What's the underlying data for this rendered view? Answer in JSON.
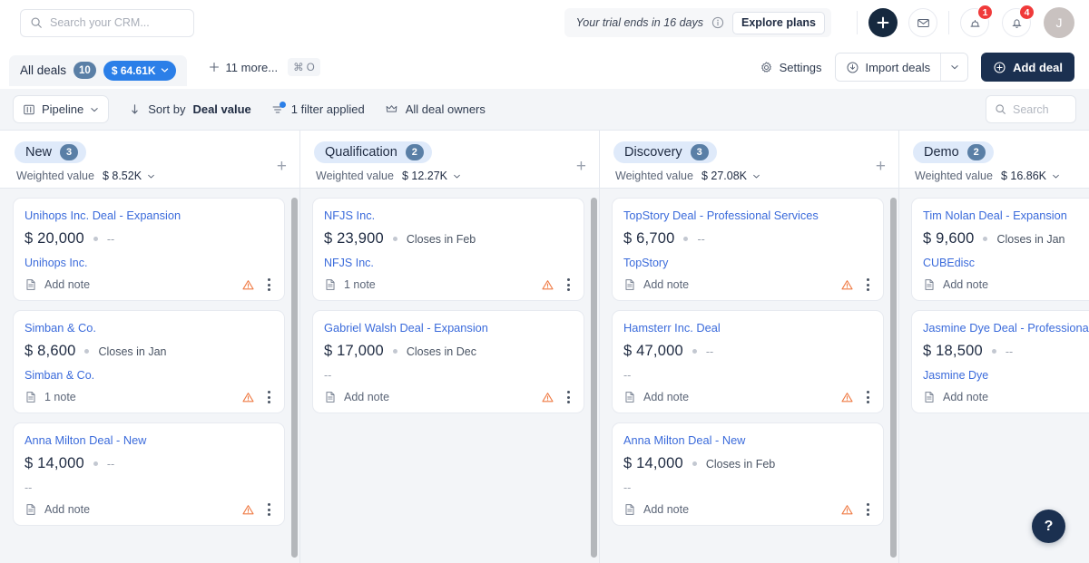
{
  "topbar": {
    "search_placeholder": "Search your CRM...",
    "search_value": "",
    "trial_text": "Your trial ends in 16 days",
    "explore_label": "Explore plans",
    "tasks_badge": "1",
    "notifications_badge": "4",
    "avatar_initial": "J"
  },
  "dealsbar": {
    "tab_label": "All deals",
    "tab_count": "10",
    "tab_value": "$ 64.61K",
    "more_label": "11 more...",
    "shortcut": "⌘ O",
    "settings_label": "Settings",
    "import_label": "Import deals",
    "add_deal_label": "Add deal"
  },
  "filterbar": {
    "pipeline_label": "Pipeline",
    "sort_prefix": "Sort by",
    "sort_field": "Deal value",
    "filter_label": "1 filter applied",
    "owners_label": "All deal owners",
    "search_placeholder": "Search",
    "search_value": ""
  },
  "board": {
    "weighted_label": "Weighted value",
    "add_note_label": "Add note",
    "empty_value": "--",
    "columns": [
      {
        "name": "New",
        "count": "3",
        "weighted_value": "$ 8.52K",
        "cards": [
          {
            "title": "Unihops Inc. Deal - Expansion",
            "amount": "$ 20,000",
            "close": "--",
            "close_empty": true,
            "org": "Unihops Inc.",
            "org_empty": false,
            "note": "Add note",
            "warning": true
          },
          {
            "title": "Simban & Co.",
            "amount": "$ 8,600",
            "close": "Closes in Jan",
            "close_empty": false,
            "org": "Simban & Co.",
            "org_empty": false,
            "note": "1 note",
            "warning": true
          },
          {
            "title": "Anna Milton Deal - New",
            "amount": "$ 14,000",
            "close": "--",
            "close_empty": true,
            "org": "--",
            "org_empty": true,
            "note": "Add note",
            "warning": true
          }
        ]
      },
      {
        "name": "Qualification",
        "count": "2",
        "weighted_value": "$ 12.27K",
        "cards": [
          {
            "title": "NFJS Inc.",
            "amount": "$ 23,900",
            "close": "Closes in Feb",
            "close_empty": false,
            "org": "NFJS Inc.",
            "org_empty": false,
            "note": "1 note",
            "warning": true
          },
          {
            "title": "Gabriel Walsh Deal - Expansion",
            "amount": "$ 17,000",
            "close": "Closes in Dec",
            "close_empty": false,
            "org": "--",
            "org_empty": true,
            "note": "Add note",
            "warning": true
          }
        ]
      },
      {
        "name": "Discovery",
        "count": "3",
        "weighted_value": "$ 27.08K",
        "cards": [
          {
            "title": "TopStory Deal - Professional Services",
            "amount": "$ 6,700",
            "close": "--",
            "close_empty": true,
            "org": "TopStory",
            "org_empty": false,
            "note": "Add note",
            "warning": true
          },
          {
            "title": "Hamsterr Inc. Deal",
            "amount": "$ 47,000",
            "close": "--",
            "close_empty": true,
            "org": "--",
            "org_empty": true,
            "note": "Add note",
            "warning": true
          },
          {
            "title": "Anna Milton Deal - New",
            "amount": "$ 14,000",
            "close": "Closes in Feb",
            "close_empty": false,
            "org": "--",
            "org_empty": true,
            "note": "Add note",
            "warning": true
          }
        ]
      },
      {
        "name": "Demo",
        "count": "2",
        "weighted_value": "$ 16.86K",
        "cards": [
          {
            "title": "Tim Nolan Deal - Expansion",
            "amount": "$ 9,600",
            "close": "Closes in Jan",
            "close_empty": false,
            "org": "CUBEdisc",
            "org_empty": false,
            "note": "Add note",
            "warning": false
          },
          {
            "title": "Jasmine Dye Deal - Professional Services",
            "amount": "$ 18,500",
            "close": "--",
            "close_empty": true,
            "org": "Jasmine Dye",
            "org_empty": false,
            "note": "Add note",
            "warning": false
          }
        ]
      }
    ]
  },
  "help": {
    "label": "?"
  },
  "colors": {
    "accent_blue": "#2b7fe8",
    "link_blue": "#3b6bdb",
    "dark_navy": "#1b3050",
    "badge_red": "#f03a3a",
    "warning_orange": "#ef7b45",
    "stage_pill_bg": "#dfeafa",
    "board_bg": "#f3f5f8"
  }
}
